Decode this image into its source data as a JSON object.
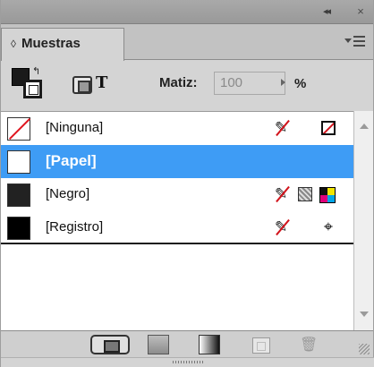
{
  "panel": {
    "tab_label": "Muestras",
    "tab_arrows": "◊"
  },
  "controls": {
    "tint_label": "Matiz:",
    "tint_value": "100",
    "tint_unit": "%"
  },
  "swatches": [
    {
      "label": "[Ninguna]",
      "selected": false
    },
    {
      "label": "[Papel]",
      "selected": true
    },
    {
      "label": "[Negro]",
      "selected": false
    },
    {
      "label": "[Registro]",
      "selected": false
    }
  ],
  "colors": {
    "selection": "#3e9cf5",
    "none_red": "#e0141e",
    "black": "#1a1a1a"
  }
}
